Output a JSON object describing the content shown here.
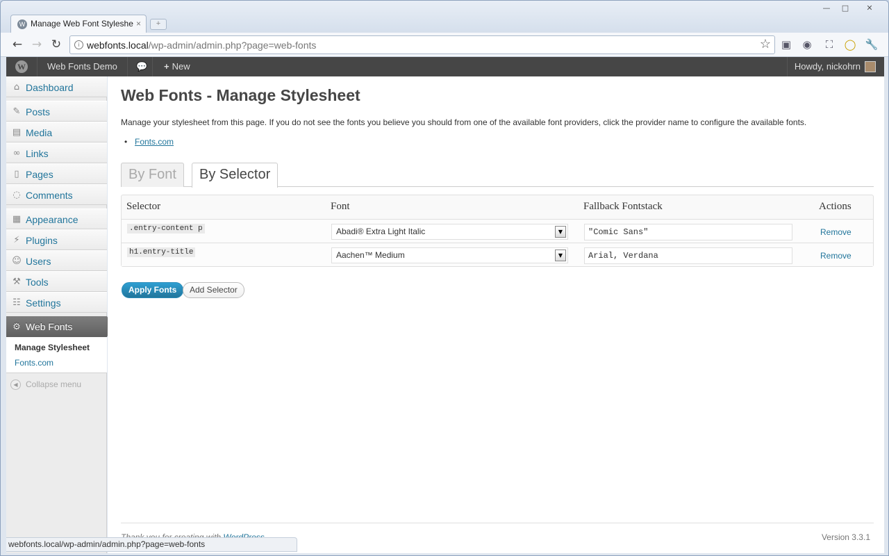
{
  "browser": {
    "tab_title": "Manage Web Font Styleshe",
    "url_host": "webfonts.local",
    "url_path": "/wp-admin/admin.php?page=web-fonts",
    "status_url": "webfonts.local/wp-admin/admin.php?page=web-fonts"
  },
  "adminbar": {
    "site_name": "Web Fonts Demo",
    "new_label": "New",
    "howdy": "Howdy, nickohrn"
  },
  "menu": {
    "items": [
      {
        "label": "Dashboard",
        "icon": "dashboard-icon"
      },
      {
        "label": "Posts",
        "icon": "pin-icon"
      },
      {
        "label": "Media",
        "icon": "media-icon"
      },
      {
        "label": "Links",
        "icon": "link-icon"
      },
      {
        "label": "Pages",
        "icon": "pages-icon"
      },
      {
        "label": "Comments",
        "icon": "comment-icon"
      },
      {
        "label": "Appearance",
        "icon": "appearance-icon"
      },
      {
        "label": "Plugins",
        "icon": "plugin-icon"
      },
      {
        "label": "Users",
        "icon": "users-icon"
      },
      {
        "label": "Tools",
        "icon": "tools-icon"
      },
      {
        "label": "Settings",
        "icon": "settings-icon"
      }
    ],
    "active": {
      "label": "Web Fonts",
      "icon": "gear-icon"
    },
    "submenu": [
      "Manage Stylesheet",
      "Fonts.com"
    ],
    "collapse": "Collapse menu"
  },
  "main": {
    "title": "Web Fonts - Manage Stylesheet",
    "intro": "Manage your stylesheet from this page. If you do not see the fonts you believe you should from one of the available font providers, click the provider name to configure the available fonts.",
    "providers": [
      "Fonts.com"
    ],
    "tabs": [
      "By Font",
      "By Selector"
    ],
    "active_tab": "By Selector",
    "table": {
      "headers": [
        "Selector",
        "Font",
        "Fallback Fontstack",
        "Actions"
      ],
      "rows": [
        {
          "selector": ".entry-content p",
          "font": "Abadi® Extra Light Italic",
          "fallback": "\"Comic Sans\"",
          "action": "Remove"
        },
        {
          "selector": "h1.entry-title",
          "font": "Aachen™ Medium",
          "fallback": "Arial, Verdana",
          "action": "Remove"
        }
      ]
    },
    "apply_label": "Apply Fonts",
    "add_label": "Add Selector"
  },
  "footer": {
    "thanks_prefix": "Thank you for creating with ",
    "thanks_link": "WordPress",
    "version": "Version 3.3.1"
  },
  "colors": {
    "link": "#21759b",
    "adminbar": "#464646",
    "primary_button": "#21759b"
  }
}
